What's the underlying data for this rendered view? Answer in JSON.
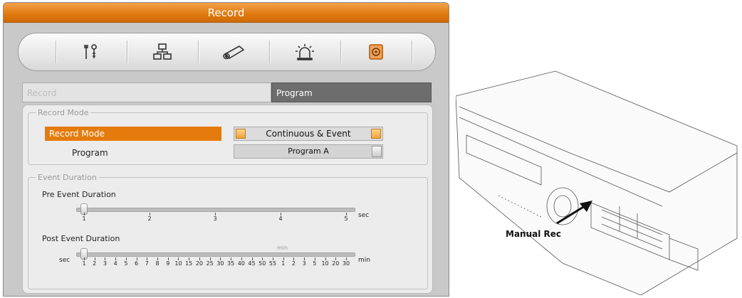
{
  "window": {
    "title": "Record"
  },
  "toolbar": {
    "icons": [
      "tools-icon",
      "network-icon",
      "camera-icon",
      "alarm-icon",
      "record-icon"
    ],
    "active_color": "#e57b0c"
  },
  "tabs": {
    "record": "Record",
    "program": "Program"
  },
  "record_mode": {
    "legend": "Record Mode",
    "mode_label": "Record Mode",
    "mode_value": "Continuous & Event",
    "program_label": "Program",
    "program_value": "Program A"
  },
  "event_duration": {
    "legend": "Event Duration",
    "pre_label": "Pre Event Duration",
    "pre_ticks": [
      "1",
      "2",
      "3",
      "4",
      "5"
    ],
    "pre_unit": "sec",
    "pre_value": "1",
    "post_label": "Post Event Duration",
    "post_unit_left": "sec",
    "post_unit_mid": "min",
    "post_unit_right": "min",
    "post_ticks": [
      "1",
      "2",
      "3",
      "4",
      "5",
      "6",
      "7",
      "8",
      "9",
      "10",
      "15",
      "20",
      "25",
      "30",
      "35",
      "40",
      "45",
      "50",
      "55",
      "1",
      "2",
      "3",
      "5",
      "10",
      "20",
      "30"
    ],
    "post_value": "1"
  },
  "illustration": {
    "callout": "Manual Rec"
  },
  "colors": {
    "accent": "#e57b0c",
    "title_bar": "#e0790f"
  }
}
